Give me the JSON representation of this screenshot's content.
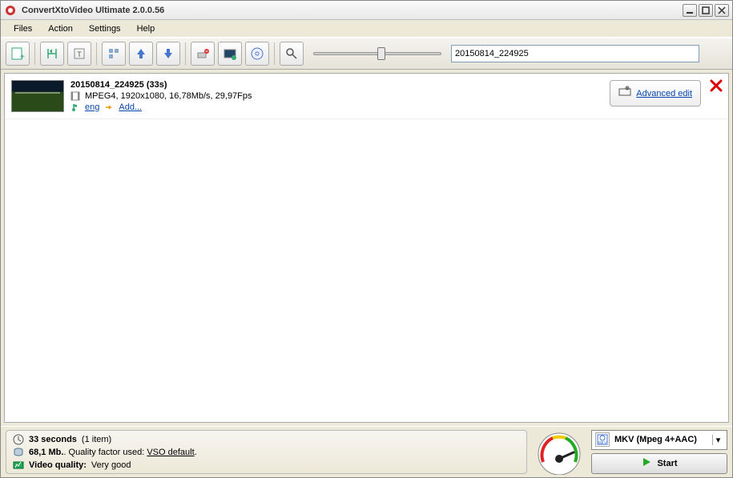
{
  "app": {
    "title": "ConvertXtoVideo Ultimate 2.0.0.56"
  },
  "menu": {
    "files": "Files",
    "action": "Action",
    "settings": "Settings",
    "help": "Help"
  },
  "toolbar": {
    "filename_field": "20150814_224925"
  },
  "item": {
    "title": "20150814_224925 (33s)",
    "details": "MPEG4, 1920x1080, 16,78Mb/s, 29,97Fps",
    "lang": "eng",
    "add": "Add...",
    "advanced_edit": "Advanced edit"
  },
  "status": {
    "duration_bold": "33 seconds",
    "duration_items": "(1 item)",
    "size_bold": "68,1 Mb.",
    "size_suffix": ". Quality factor used: ",
    "size_quality_link": "VSO default",
    "size_period": ".",
    "quality_label": "Video quality:",
    "quality_value": "Very good"
  },
  "output": {
    "format": "MKV (Mpeg 4+AAC)",
    "format_badge": "MKV",
    "start": "Start"
  }
}
